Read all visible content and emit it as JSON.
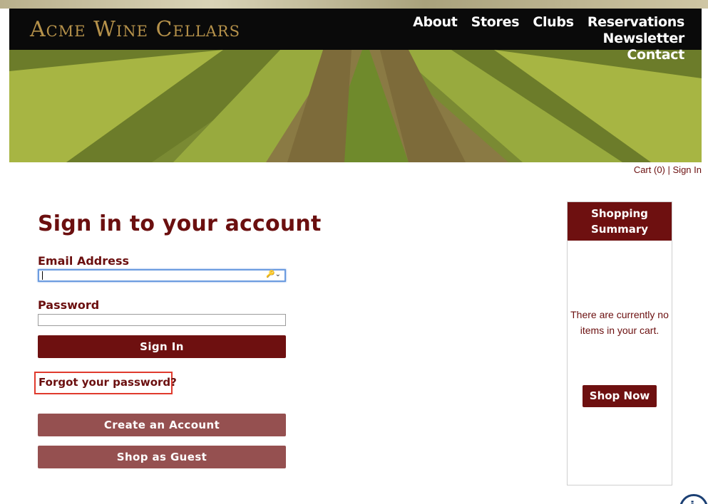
{
  "brand": {
    "logo_text": "Acme Wine Cellars",
    "accent_color": "#6e1010"
  },
  "nav": {
    "items": [
      "About",
      "Stores",
      "Clubs",
      "Reservations",
      "Newsletter",
      "Contact"
    ]
  },
  "cart_link": {
    "cart_label": "Cart (0)",
    "separator": "|",
    "signin_label": "Sign In"
  },
  "signin": {
    "title": "Sign in to your account",
    "email_label": "Email Address",
    "email_value": "",
    "password_label": "Password",
    "password_value": "",
    "signin_button": "Sign In",
    "forgot_link": "Forgot your password?",
    "create_button": "Create an Account",
    "guest_button": "Shop as Guest"
  },
  "summary": {
    "heading": "Shopping Summary",
    "empty_text": "There are currently no items in your cart.",
    "shop_now": "Shop Now"
  },
  "icons": {
    "email_field_icon": "key-icon",
    "badge_icon": "info-icon"
  }
}
